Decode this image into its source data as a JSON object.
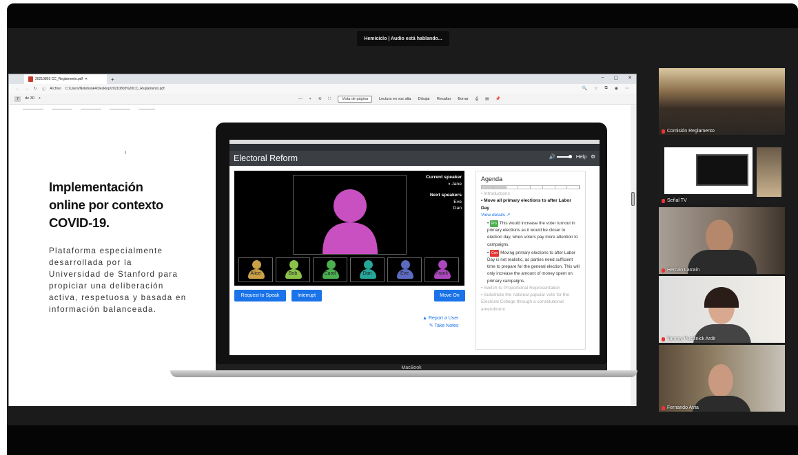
{
  "meeting": {
    "banner": "Hemiciclo | Audio está hablando...",
    "participants": [
      {
        "name": "Comisión Reglamento"
      },
      {
        "name": "Señal TV"
      },
      {
        "name": "Hernán Larraín"
      },
      {
        "name": "Tammy Pustilnick Ardit"
      },
      {
        "name": "Fernando Atria"
      }
    ]
  },
  "browser": {
    "tab_title": "20210803 CC_Reglamento.pdf",
    "address_label": "Archivo",
    "url": "C:/Users/Notebook4/Desktop/20210803%20CC_Reglamento.pdf",
    "page_current": "7",
    "page_total": "de 30",
    "toolbar": {
      "page_view": "Vista de página",
      "read_aloud": "Lectura en voz alta",
      "draw": "Dibujar",
      "highlight": "Resaltar",
      "erase": "Borrar"
    }
  },
  "slide": {
    "heading_lines": [
      "Implementación",
      "online por contexto",
      "COVID-19."
    ],
    "description": "Plataforma especialmente desarrollada por la Universidad de Stanford para propiciar una deliberación activa, respetuosa y basada en información balanceada.",
    "laptop_label": "MacBook"
  },
  "app": {
    "title": "Electoral Reform",
    "help": "Help",
    "current_speaker_label": "Current speaker",
    "current_speaker": "Jane",
    "next_speakers_label": "Next speakers",
    "next_speakers": [
      "Eve",
      "Dan"
    ],
    "participants": [
      {
        "name": "Alice",
        "color": "#c9a046"
      },
      {
        "name": "Bob",
        "color": "#8bc34a"
      },
      {
        "name": "Carol",
        "color": "#4caf50"
      },
      {
        "name": "Dan",
        "color": "#26a69a"
      },
      {
        "name": "Eve",
        "color": "#5c6bc0"
      },
      {
        "name": "Frank",
        "color": "#ab47bc"
      }
    ],
    "speaker_color": "#c850c0",
    "buttons": {
      "request": "Request to Speak",
      "interrupt": "Interrupt",
      "move_on": "Move On"
    },
    "links": {
      "report": "Report a User",
      "notes": "Take Notes"
    },
    "agenda": {
      "title": "Agenda",
      "items": [
        "Introductions",
        "Move all primary elections to after Labor Day",
        "Switch to Proportional Representation",
        "Substitute the national popular vote for the Electoral College through a constitutional amendment"
      ],
      "view_details": "View details",
      "pro_tag": "Pro",
      "pro_text": "This would increase the voter turnout in primary elections as it would be closer to election day, when voters pay more attention to campaigns.",
      "con_tag": "Con",
      "con_text": "Moving primary elections to after Labor Day is not realistic, as parties need sufficient time to prepare for the general election. This will only increase the amount of money spent on primary campaigns."
    }
  }
}
